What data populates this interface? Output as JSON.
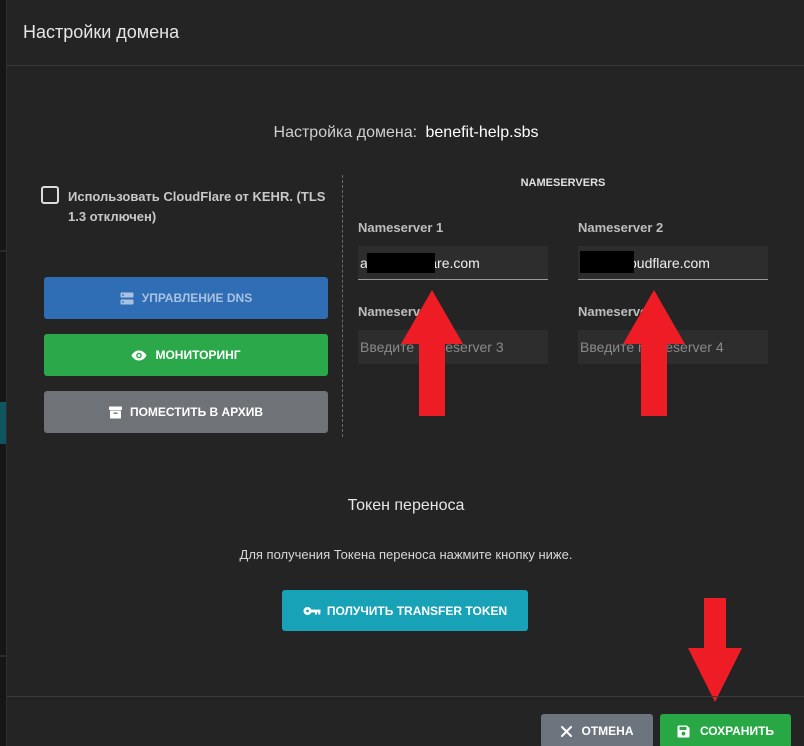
{
  "modal": {
    "title": "Настройки домена",
    "domain_prefix": "Настройка домена:",
    "domain_name": "benefit-help.sbs"
  },
  "cloudflare": {
    "label": "Использовать CloudFlare от KEHR. (TLS 1.3 отключен)",
    "checked": false
  },
  "actions": {
    "dns_label": "УПРАВЛЕНИЕ DNS",
    "monitoring_label": "МОНИТОРИНГ",
    "archive_label": "ПОМЕСТИТЬ В АРХИВ"
  },
  "nameservers": {
    "title": "NAMESERVERS",
    "items": [
      {
        "label": "Nameserver 1",
        "value": "a        oudflare.com",
        "placeholder": ""
      },
      {
        "label": "Nameserver 2",
        "value": "          cloudflare.com",
        "placeholder": ""
      },
      {
        "label": "Nameserver 3",
        "value": "",
        "placeholder": "Введите nameserver 3"
      },
      {
        "label": "Nameserver 4",
        "value": "",
        "placeholder": "Введите nameserver 4"
      }
    ]
  },
  "transfer": {
    "title": "Токен переноса",
    "description": "Для получения Токена переноса нажмите кнопку ниже.",
    "button_label": "ПОЛУЧИТЬ TRANSFER TOKEN"
  },
  "footer": {
    "cancel_label": "ОТМЕНА",
    "save_label": "СОХРАНИТЬ"
  },
  "colors": {
    "accent_blue": "#2f6db4",
    "accent_green": "#28a745",
    "accent_cyan": "#17a2b8",
    "annotation_red": "#ee1c25"
  }
}
